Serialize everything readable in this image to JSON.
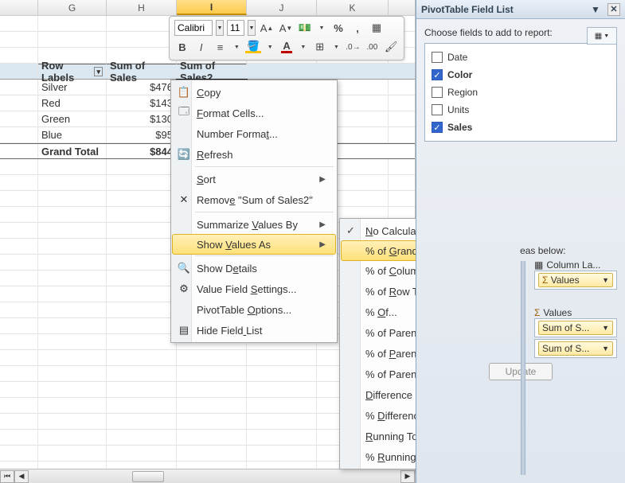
{
  "columns": [
    "G",
    "H",
    "I",
    "J",
    "K"
  ],
  "selected_col_index": 2,
  "pivot": {
    "headers": [
      "Row Labels",
      "Sum of Sales",
      "Sum of Sales2"
    ],
    "rows": [
      {
        "label": "Silver",
        "val": "$476"
      },
      {
        "label": "Red",
        "val": "$143"
      },
      {
        "label": "Green",
        "val": "$130"
      },
      {
        "label": "Blue",
        "val": "$95"
      }
    ],
    "grand_label": "Grand Total",
    "grand_val": "$844"
  },
  "mini_toolbar": {
    "font": "Calibri",
    "size": "11",
    "buttons_row1": [
      "A▲",
      "A▼",
      "⎙",
      "%",
      ",",
      "☰"
    ],
    "buttons_row2": [
      "B",
      "I",
      "≡",
      "A",
      "A",
      "⊞",
      "⁰₀",
      "⁰₀",
      "✎"
    ]
  },
  "ctx1": [
    {
      "icon": "copy-icon",
      "label": "Copy",
      "u": 0
    },
    {
      "icon": "format-cells-icon",
      "label": "Format Cells...",
      "u": 0
    },
    {
      "icon": "",
      "label": "Number Format...",
      "u": 12
    },
    {
      "icon": "refresh-icon",
      "label": "Refresh",
      "u": 0
    },
    {
      "sep": true
    },
    {
      "icon": "",
      "label": "Sort",
      "u": 0,
      "arrow": true
    },
    {
      "icon": "remove-icon",
      "label": "Remove \"Sum of Sales2\"",
      "u": 5
    },
    {
      "sep": true
    },
    {
      "icon": "",
      "label": "Summarize Values By",
      "u": 10,
      "arrow": true
    },
    {
      "icon": "",
      "label": "Show Values As",
      "u": 5,
      "arrow": true,
      "hover": true
    },
    {
      "sep": true
    },
    {
      "icon": "show-details-icon",
      "label": "Show Details",
      "u": 6
    },
    {
      "icon": "value-field-settings-icon",
      "label": "Value Field Settings...",
      "u": 12
    },
    {
      "icon": "",
      "label": "PivotTable Options...",
      "u": 11
    },
    {
      "icon": "hide-field-list-icon",
      "label": "Hide Field List",
      "u": 10
    }
  ],
  "ctx2": [
    {
      "check": true,
      "label": "No Calculation",
      "u": 0
    },
    {
      "label": "% of Grand Total",
      "u": 5,
      "hover": true
    },
    {
      "label": "% of Column Total",
      "u": 5
    },
    {
      "label": "% of Row Total",
      "u": 5
    },
    {
      "label": "% Of...",
      "u": 2
    },
    {
      "label": "% of Parent Row Total",
      "u": 12
    },
    {
      "label": "% of Parent Column Total",
      "u": 5
    },
    {
      "label": "% of Parent Total...",
      "u": 12
    },
    {
      "label": "Difference From...",
      "u": 0
    },
    {
      "label": "% Difference From...",
      "u": 2
    },
    {
      "label": "Running Total In...",
      "u": 0
    },
    {
      "label": "% Running Total In...",
      "u": 2
    }
  ],
  "sidebar": {
    "title": "PivotTable Field List",
    "hint": "Choose fields to add to report:",
    "fields": [
      {
        "name": "Date",
        "checked": false
      },
      {
        "name": "Color",
        "checked": true
      },
      {
        "name": "Region",
        "checked": false
      },
      {
        "name": "Units",
        "checked": false
      },
      {
        "name": "Sales",
        "checked": true
      }
    ],
    "areas_hint": "eas below:",
    "col_labels": "Column La...",
    "values_drop": "Values",
    "values_head": "Values",
    "sum_item": "Sum of S...",
    "update": "Update"
  }
}
